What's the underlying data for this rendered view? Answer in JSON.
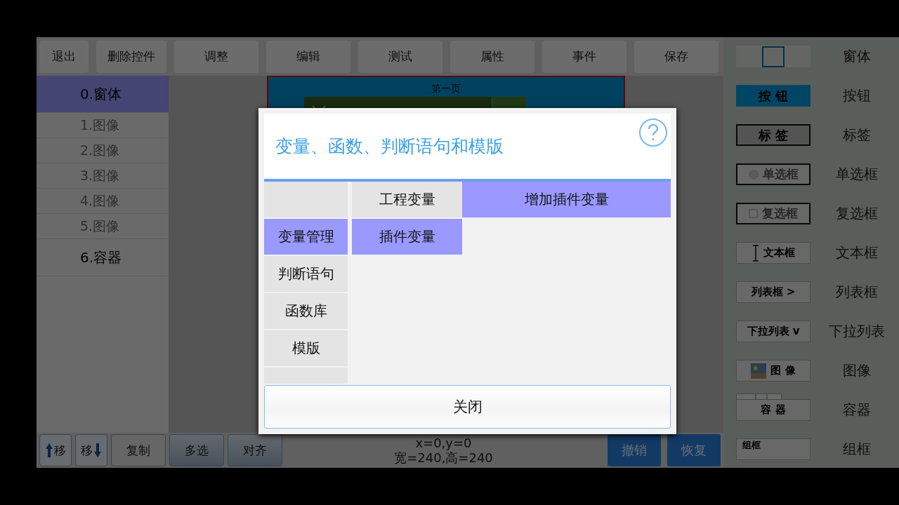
{
  "toolbar": [
    {
      "label": "退出"
    },
    {
      "label": "删除控件"
    },
    {
      "label": "调整"
    },
    {
      "label": "编辑"
    },
    {
      "label": "测试"
    },
    {
      "label": "属性"
    },
    {
      "label": "事件"
    },
    {
      "label": "保存"
    }
  ],
  "object_list": [
    {
      "label": "0.窗体",
      "selected": true,
      "disabled": false
    },
    {
      "label": "1.图像",
      "selected": false,
      "disabled": true
    },
    {
      "label": "2.图像",
      "selected": false,
      "disabled": true
    },
    {
      "label": "3.图像",
      "selected": false,
      "disabled": true
    },
    {
      "label": "4.图像",
      "selected": false,
      "disabled": true
    },
    {
      "label": "5.图像",
      "selected": false,
      "disabled": true
    },
    {
      "label": "6.容器",
      "selected": false,
      "disabled": false
    }
  ],
  "canvas": {
    "page_label": "第一页"
  },
  "bottom_bar": {
    "buttons": [
      {
        "kind": "up",
        "label": "移"
      },
      {
        "kind": "down",
        "label": "移"
      },
      {
        "kind": "plain",
        "label": "复制"
      },
      {
        "kind": "shaded",
        "label": "多选"
      },
      {
        "kind": "shaded",
        "label": "对齐"
      }
    ],
    "position": "x=0,y=0",
    "size": "宽=240,高=240",
    "actions": [
      {
        "label": "撤销"
      },
      {
        "label": "恢复"
      }
    ]
  },
  "palette": [
    {
      "kind": "window",
      "label": "窗体"
    },
    {
      "kind": "button",
      "sample": "按 钮",
      "label": "按钮"
    },
    {
      "kind": "label",
      "sample": "标 签",
      "label": "标签"
    },
    {
      "kind": "radio",
      "sample": "单选框",
      "label": "单选框"
    },
    {
      "kind": "checkbox",
      "sample": "复选框",
      "label": "复选框"
    },
    {
      "kind": "textbox",
      "sample": "文本框",
      "label": "文本框"
    },
    {
      "kind": "listbox",
      "sample": "列表框 >",
      "label": "列表框"
    },
    {
      "kind": "dropdown",
      "sample": "下拉列表 v",
      "label": "下拉列表"
    },
    {
      "kind": "image",
      "sample": "图 像",
      "label": "图像"
    },
    {
      "kind": "container",
      "sample": "容 器",
      "label": "容器"
    },
    {
      "kind": "groupbox",
      "sample": "组框",
      "label": "组框"
    }
  ],
  "dialog": {
    "title": "变量、函数、判断语句和模版",
    "categories": [
      {
        "label": "变量管理",
        "selected": true
      },
      {
        "label": "判断语句",
        "selected": false
      },
      {
        "label": "函数库",
        "selected": false
      },
      {
        "label": "模版",
        "selected": false
      }
    ],
    "variable_tabs": [
      {
        "label": "工程变量",
        "selected": false
      },
      {
        "label": "插件变量",
        "selected": true
      }
    ],
    "add_button": "增加插件变量",
    "close_button": "关闭"
  }
}
